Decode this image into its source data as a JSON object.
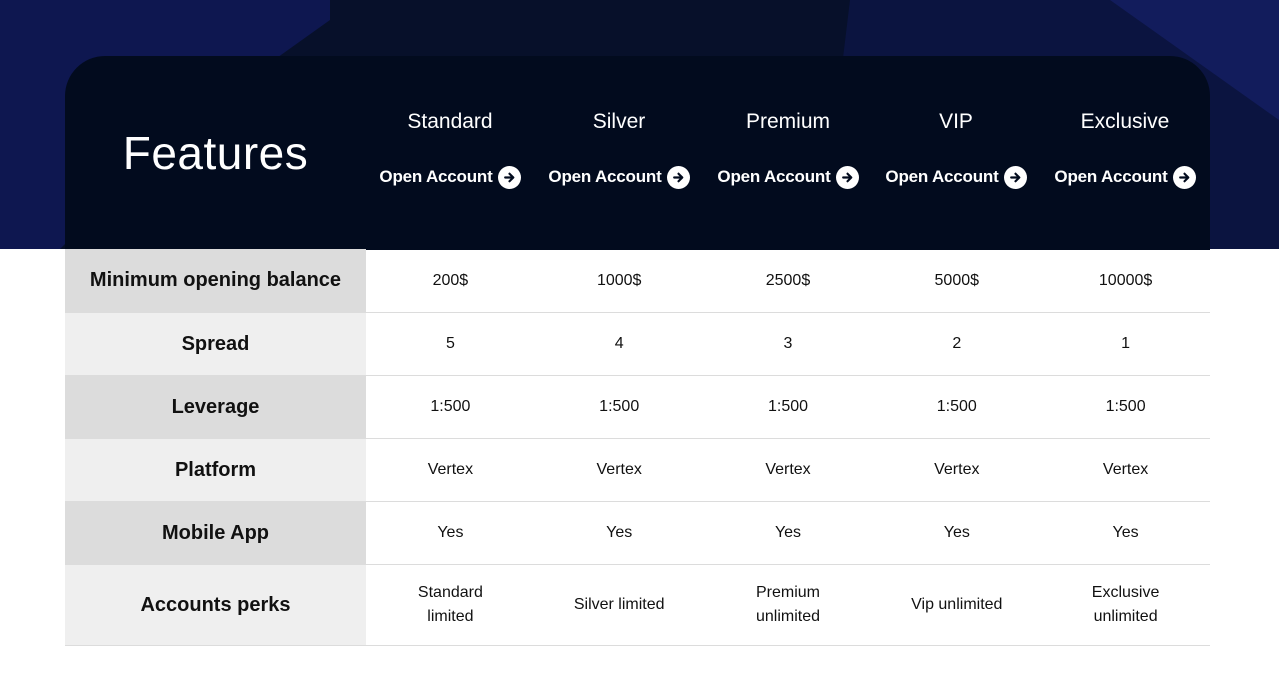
{
  "header": {
    "title": "Features",
    "plans": [
      {
        "name": "Standard",
        "cta": "Open Account"
      },
      {
        "name": "Silver",
        "cta": "Open Account"
      },
      {
        "name": "Premium",
        "cta": "Open Account"
      },
      {
        "name": "VIP",
        "cta": "Open Account"
      },
      {
        "name": "Exclusive",
        "cta": "Open Account"
      }
    ]
  },
  "rows": [
    {
      "label": "Minimum opening balance",
      "values": [
        "200$",
        "1000$",
        "2500$",
        "5000$",
        "10000$"
      ]
    },
    {
      "label": "Spread",
      "values": [
        "5",
        "4",
        "3",
        "2",
        "1"
      ]
    },
    {
      "label": "Leverage",
      "values": [
        "1:500",
        "1:500",
        "1:500",
        "1:500",
        "1:500"
      ]
    },
    {
      "label": "Platform",
      "values": [
        "Vertex",
        "Vertex",
        "Vertex",
        "Vertex",
        "Vertex"
      ]
    },
    {
      "label": "Mobile App",
      "values": [
        "Yes",
        "Yes",
        "Yes",
        "Yes",
        "Yes"
      ]
    },
    {
      "label": "Accounts perks",
      "values": [
        "Standard limited",
        "Silver limited",
        "Premium unlimited",
        "Vip unlimited",
        "Exclusive unlimited"
      ]
    }
  ],
  "icons": {
    "cta": "arrow-right-circle-icon"
  },
  "colors": {
    "header_bg": "#020b1e",
    "hero_bg": "#07102a",
    "accent_blue": "#141c5e"
  }
}
